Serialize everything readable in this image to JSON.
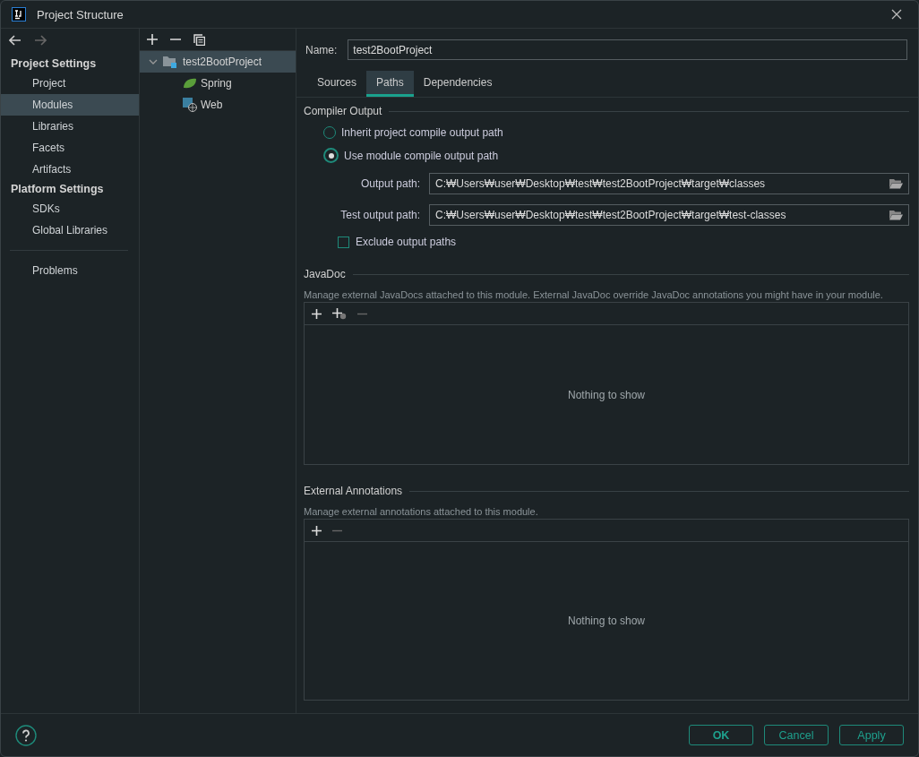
{
  "window": {
    "title": "Project Structure"
  },
  "nav": {
    "sections": [
      {
        "heading": "Project Settings",
        "items": [
          {
            "label": "Project",
            "selected": false
          },
          {
            "label": "Modules",
            "selected": true
          },
          {
            "label": "Libraries",
            "selected": false
          },
          {
            "label": "Facets",
            "selected": false
          },
          {
            "label": "Artifacts",
            "selected": false
          }
        ]
      },
      {
        "heading": "Platform Settings",
        "items": [
          {
            "label": "SDKs",
            "selected": false
          },
          {
            "label": "Global Libraries",
            "selected": false
          }
        ]
      }
    ],
    "extra_items": [
      {
        "label": "Problems",
        "selected": false
      }
    ]
  },
  "tree": [
    {
      "label": "test2BootProject",
      "selected": true,
      "expanded": true,
      "children": [
        {
          "label": "Spring",
          "kind": "spring"
        },
        {
          "label": "Web",
          "kind": "web"
        }
      ]
    }
  ],
  "name_field": {
    "label": "Name:",
    "value": "test2BootProject"
  },
  "tabs": [
    {
      "label": "Sources",
      "selected": false
    },
    {
      "label": "Paths",
      "selected": true
    },
    {
      "label": "Dependencies",
      "selected": false
    }
  ],
  "compiler_output": {
    "title": "Compiler Output",
    "options": [
      {
        "label": "Inherit project compile output path",
        "selected": false
      },
      {
        "label": "Use module compile output path",
        "selected": true
      }
    ],
    "paths": [
      {
        "label": "Output path:",
        "value": "C:₩Users₩user₩Desktop₩test₩test2BootProject₩target₩classes"
      },
      {
        "label": "Test output path:",
        "value": "C:₩Users₩user₩Desktop₩test₩test2BootProject₩target₩test-classes"
      }
    ],
    "exclude": {
      "label": "Exclude output paths",
      "checked": false
    }
  },
  "javadoc": {
    "title": "JavaDoc",
    "description": "Manage external JavaDocs attached to this module. External JavaDoc override JavaDoc annotations you might have in your module.",
    "empty_text": "Nothing to show",
    "tools": [
      {
        "kind": "add"
      },
      {
        "kind": "add-url"
      },
      {
        "kind": "remove"
      }
    ]
  },
  "external_annotations": {
    "title": "External Annotations",
    "description": "Manage external annotations attached to this module.",
    "empty_text": "Nothing to show",
    "tools": [
      {
        "kind": "add"
      },
      {
        "kind": "remove"
      }
    ]
  },
  "buttons": [
    {
      "label": "OK",
      "kind": "primary"
    },
    {
      "label": "Cancel",
      "kind": "normal"
    },
    {
      "label": "Apply",
      "kind": "normal"
    }
  ]
}
